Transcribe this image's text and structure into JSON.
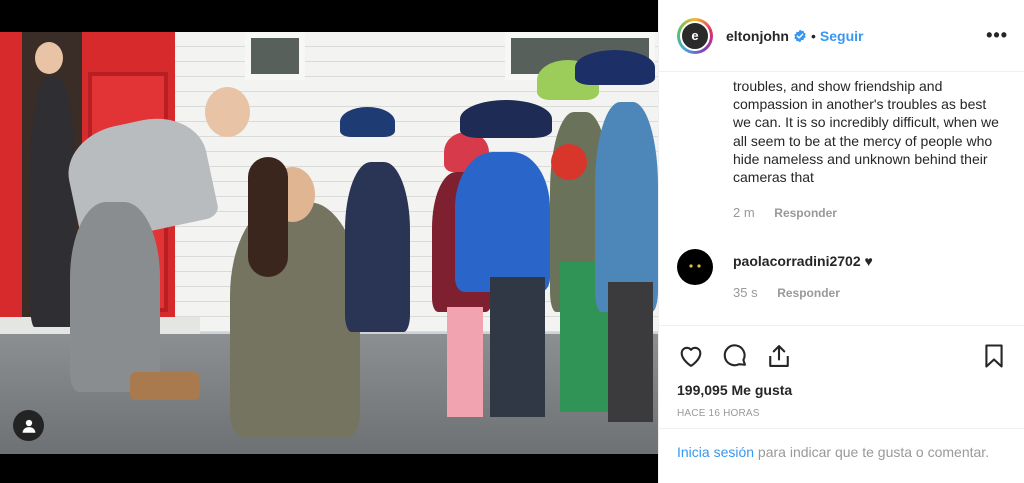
{
  "post": {
    "username": "eltonjohn",
    "separator": "•",
    "follow_label": "Seguir",
    "more_label": "•••",
    "caption_text": "troubles, and show friendship and compassion in another's troubles as best we can. It is so incredibly difficult, when we all seem to be at the mercy of people who hide nameless and unknown behind their cameras that",
    "caption_age": "2 m",
    "reply_label": "Responder",
    "comment": {
      "username": "paolacorradini2702",
      "text": "♥",
      "age": "35 s",
      "reply_label": "Responder"
    },
    "likes_count": "199,095",
    "likes_label": "Me gusta",
    "posted_time": "HACE 16 HORAS",
    "login_link": "Inicia sesión",
    "login_rest": " para indicar que te gusta o comentar."
  },
  "icons": {
    "verified": "verified-badge-icon",
    "heart": "heart-icon",
    "comment": "comment-icon",
    "share": "share-icon",
    "save": "bookmark-icon",
    "user_tag": "user-icon"
  },
  "colors": {
    "link": "#3897f0",
    "text": "#262626",
    "muted": "#999999",
    "border": "#efefef"
  }
}
